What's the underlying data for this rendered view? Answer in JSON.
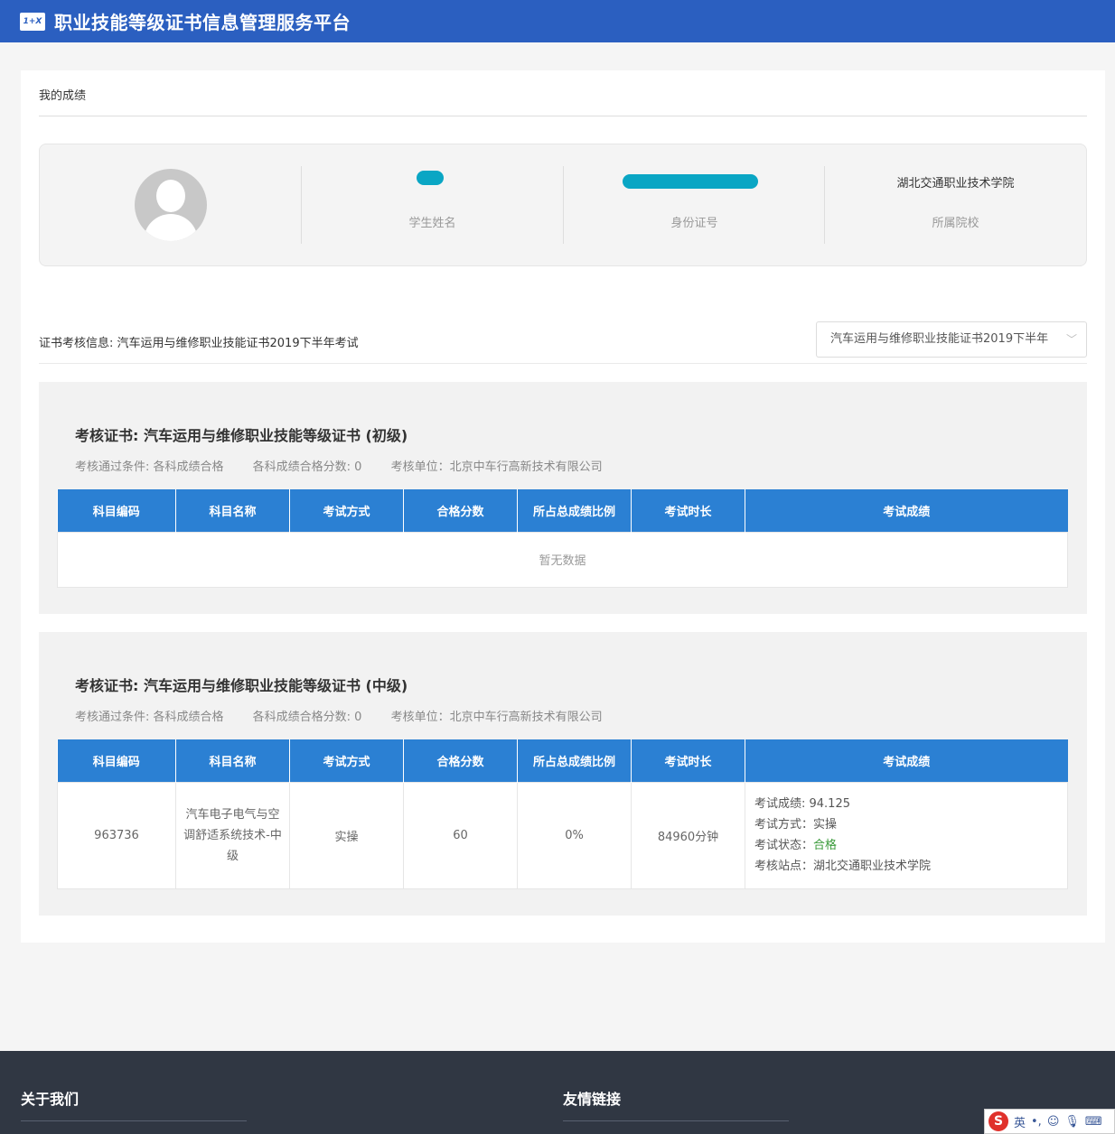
{
  "header": {
    "logo_text": "1+X",
    "title": "职业技能等级证书信息管理服务平台"
  },
  "page": {
    "section_title": "我的成绩"
  },
  "profile": {
    "name_label": "学生姓名",
    "id_label": "身份证号",
    "school_value": "湖北交通职业技术学院",
    "school_label": "所属院校"
  },
  "cert_info": {
    "text": "证书考核信息: 汽车运用与维修职业技能证书2019下半年考试",
    "select_value": "汽车运用与维修职业技能证书2019下半年"
  },
  "table_headers": [
    "科目编码",
    "科目名称",
    "考试方式",
    "合格分数",
    "所占总成绩比例",
    "考试时长",
    "考试成绩"
  ],
  "certs": [
    {
      "title": "考核证书: 汽车运用与维修职业技能等级证书 (初级)",
      "cond_pass": "考核通过条件: 各科成绩合格",
      "cond_score": "各科成绩合格分数: 0",
      "cond_unit": "考核单位：北京中车行高新技术有限公司",
      "empty_text": "暂无数据"
    },
    {
      "title": "考核证书: 汽车运用与维修职业技能等级证书 (中级)",
      "cond_pass": "考核通过条件: 各科成绩合格",
      "cond_score": "各科成绩合格分数: 0",
      "cond_unit": "考核单位：北京中车行高新技术有限公司",
      "row": {
        "code": "963736",
        "name": "汽车电子电气与空调舒适系统技术-中级",
        "method": "实操",
        "pass_score": "60",
        "ratio": "0%",
        "duration": "84960分钟",
        "score_line": "考试成绩: 94.125",
        "method_line": "考试方式：实操",
        "status_label": "考试状态：",
        "status_value": "合格",
        "site_line": "考核站点：湖北交通职业技术学院"
      }
    }
  ],
  "footer": {
    "about": "关于我们",
    "links": "友情链接"
  },
  "ime": {
    "logo": "S",
    "lang": "英"
  },
  "colors": {
    "header": "#2b5fc0",
    "table_header": "#2b80d3",
    "footer": "#303743",
    "pass": "#3a9a3a"
  }
}
